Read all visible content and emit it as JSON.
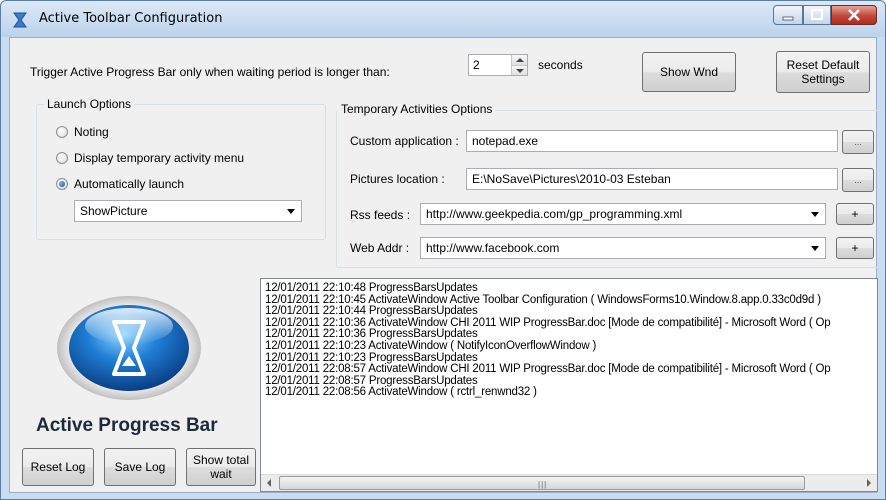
{
  "window": {
    "title": "Active Toolbar Configuration"
  },
  "trigger": {
    "label": "Trigger Active Progress Bar only when waiting period is longer than:",
    "value": "2",
    "unit": "seconds"
  },
  "buttons": {
    "show_wnd": "Show Wnd",
    "reset_default_line1": "Reset Default",
    "reset_default_line2": "Settings",
    "reset_log": "Reset Log",
    "save_log": "Save Log",
    "show_total_line1": "Show total",
    "show_total_line2": "wait",
    "browse": "...",
    "add": "+"
  },
  "launch_options": {
    "title": "Launch Options",
    "options": [
      "Noting",
      "Display temporary activity menu",
      "Automatically launch"
    ],
    "selected_index": 2,
    "dropdown_value": "ShowPicture"
  },
  "temp_options": {
    "title": "Temporary Activities Options",
    "custom_app_label": "Custom application :",
    "custom_app_value": "notepad.exe",
    "pictures_label": "Pictures location :",
    "pictures_value": "E:\\NoSave\\Pictures\\2010-03 Esteban",
    "rss_label": "Rss feeds :",
    "rss_value": "http://www.geekpedia.com/gp_programming.xml",
    "web_label": "Web Addr :",
    "web_value": "http://www.facebook.com"
  },
  "brand": {
    "name": "Active Progress Bar"
  },
  "log": [
    "12/01/2011 22:10:48 ProgressBarsUpdates",
    "12/01/2011 22:10:45 ActivateWindow Active Toolbar Configuration ( WindowsForms10.Window.8.app.0.33c0d9d )",
    "12/01/2011 22:10:44 ProgressBarsUpdates",
    "12/01/2011 22:10:36 ActivateWindow CHI 2011 WIP ProgressBar.doc [Mode de compatibilité] - Microsoft Word ( Op",
    "12/01/2011 22:10:36 ProgressBarsUpdates",
    "12/01/2011 22:10:23 ActivateWindow  ( NotifyIconOverflowWindow )",
    "12/01/2011 22:10:23 ProgressBarsUpdates",
    "12/01/2011 22:08:57 ActivateWindow CHI 2011 WIP ProgressBar.doc [Mode de compatibilité] - Microsoft Word ( Op",
    "12/01/2011 22:08:57 ProgressBarsUpdates",
    "12/01/2011 22:08:56 ActivateWindow  ( rctrl_renwnd32 )"
  ]
}
